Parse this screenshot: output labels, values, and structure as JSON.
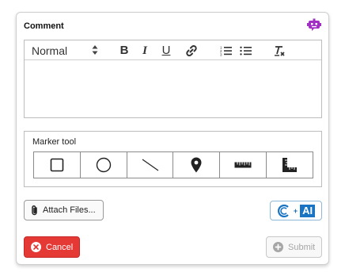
{
  "panel": {
    "title": "Comment",
    "accent_color": "#a12fc4"
  },
  "editor": {
    "format_select": "Normal",
    "toolbar_icons": [
      "bold-icon",
      "italic-icon",
      "underline-icon",
      "link-icon",
      "ordered-list-icon",
      "bullet-list-icon",
      "clear-format-icon"
    ],
    "bold_label": "B",
    "italic_label": "I",
    "underline_label": "U",
    "content": ""
  },
  "marker": {
    "label": "Marker tool",
    "tools": [
      "rectangle-icon",
      "circle-icon",
      "line-icon",
      "location-pin-icon",
      "ruler-icon",
      "angle-ruler-icon"
    ]
  },
  "actions": {
    "attach_label": "Attach Files...",
    "ai_plus": "+",
    "ai_label": "AI",
    "cancel_label": "Cancel",
    "submit_label": "Submit",
    "cancel_color": "#e53935",
    "ai_color": "#1a74c4"
  }
}
